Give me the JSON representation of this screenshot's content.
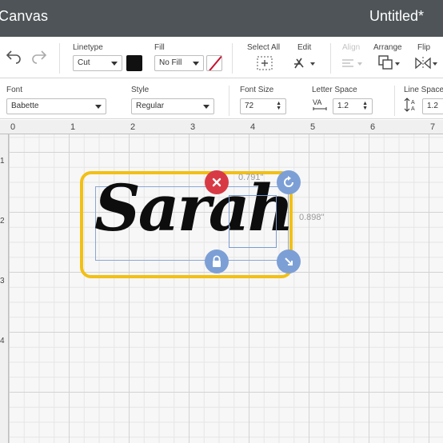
{
  "titlebar": {
    "app_title": "Canvas",
    "document_title": "Untitled*"
  },
  "toolbar": {
    "linetype_label": "Linetype",
    "linetype_value": "Cut",
    "fill_label": "Fill",
    "fill_value": "No Fill",
    "select_all_label": "Select All",
    "edit_label": "Edit",
    "align_label": "Align",
    "arrange_label": "Arrange",
    "flip_label": "Flip",
    "linetype_color": "#111111",
    "disabled_color": "#c4c4c4"
  },
  "textbar": {
    "font_label": "Font",
    "font_value": "Babette",
    "style_label": "Style",
    "style_value": "Regular",
    "font_size_label": "Font Size",
    "font_size_value": "72",
    "letter_space_label": "Letter Space",
    "letter_space_value": "1.2",
    "line_space_label": "Line Space",
    "line_space_value": "1.2"
  },
  "ruler": {
    "top_numbers": [
      "0",
      "1",
      "2",
      "3",
      "4",
      "5",
      "6",
      "7"
    ],
    "left_numbers": [
      "1",
      "2",
      "3",
      "4"
    ]
  },
  "canvas": {
    "text": "Sarah",
    "width_label": "0.791\"",
    "height_label": "0.898\"",
    "highlight_color": "#f2c014",
    "delete_color": "#d83a45",
    "handle_color": "#7c9fd6"
  }
}
